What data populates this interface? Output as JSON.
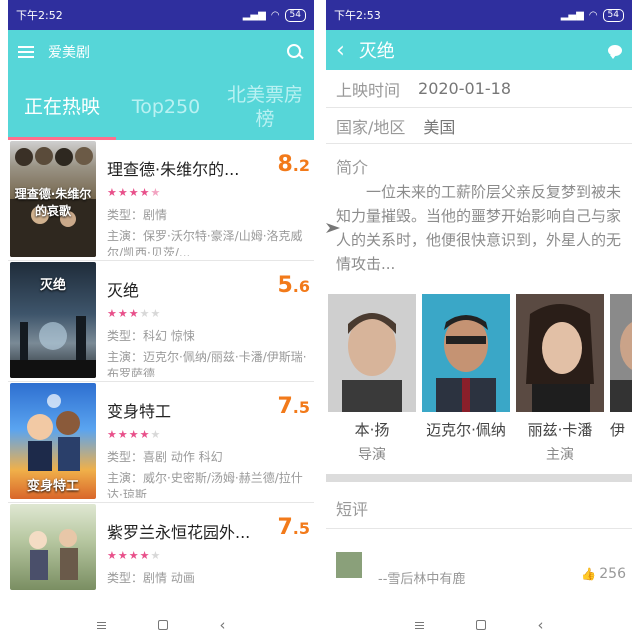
{
  "left": {
    "status": {
      "time": "下午2:52",
      "battery": "54"
    },
    "appbar": {
      "title": "爱美剧"
    },
    "tabs": [
      "正在热映",
      "Top250",
      "北美票房榜"
    ],
    "movies": [
      {
        "title": "理查德·朱维尔的...",
        "score_int": "8",
        "score_dec": ".2",
        "stars": "4.5",
        "genre_label": "类型：",
        "genre": "剧情",
        "cast_label": "主演：",
        "cast": "保罗·沃尔特·豪泽/山姆·洛克威尔/凯西·贝茨/...",
        "poster_text": "理查德·朱维尔的哀歌"
      },
      {
        "title": "灭绝",
        "score_int": "5",
        "score_dec": ".6",
        "stars": "3",
        "genre_label": "类型：",
        "genre": "科幻 惊悚",
        "cast_label": "主演：",
        "cast": "迈克尔·佩纳/丽兹·卡潘/伊斯瑞·布罗萨德",
        "poster_text": "灭绝"
      },
      {
        "title": "变身特工",
        "score_int": "7",
        "score_dec": ".5",
        "stars": "4",
        "genre_label": "类型：",
        "genre": "喜剧 动作 科幻",
        "cast_label": "主演：",
        "cast": "威尔·史密斯/汤姆·赫兰德/拉什达·琼斯",
        "poster_text": "变身特工"
      },
      {
        "title": "紫罗兰永恒花园外...",
        "score_int": "7",
        "score_dec": ".5",
        "stars": "4",
        "genre_label": "类型：",
        "genre": "剧情 动画",
        "cast_label": "主演：",
        "cast": "",
        "poster_text": ""
      }
    ]
  },
  "right": {
    "status": {
      "time": "下午2:53",
      "battery": "54"
    },
    "appbar": {
      "title": "灭绝"
    },
    "release_label": "上映时间",
    "release_value": "2020-01-18",
    "region_label": "国家/地区",
    "region_value": "美国",
    "synopsis_label": "简介",
    "synopsis": "一位未来的工薪阶层父亲反复梦到被未知力量摧毁。当他的噩梦开始影响自己与家人的关系时，他便很快意识到，外星人的无情攻击...",
    "cast": [
      {
        "name": "本·扬",
        "role": "导演"
      },
      {
        "name": "迈克尔·佩纳",
        "role": ""
      },
      {
        "name": "丽兹·卡潘",
        "role": "主演"
      },
      {
        "name": "伊",
        "role": ""
      }
    ],
    "reviews_label": "短评",
    "review": {
      "user": "--雪后林中有鹿",
      "likes": "256"
    }
  },
  "icons": [
    "menu-icon",
    "search-icon",
    "back-icon",
    "chat-icon",
    "thumb-up-icon"
  ],
  "colors": {
    "appbar": "#56d6d8",
    "statusbar": "#2f2f9e",
    "score": "#f27a1a",
    "star": "#e8508a",
    "tab_indicator": "#ff6f8c"
  }
}
